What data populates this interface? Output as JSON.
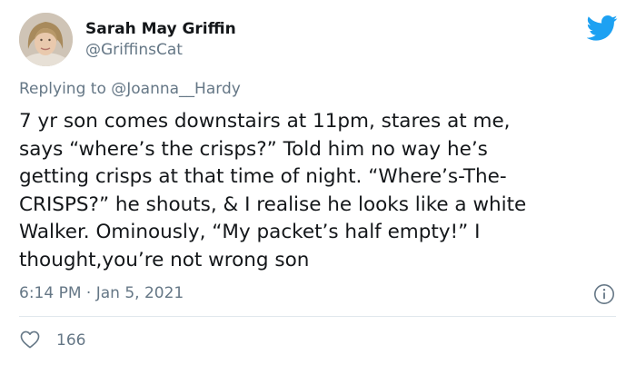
{
  "author": {
    "display_name": "Sarah May Griffin",
    "handle": "@GriffinsCat"
  },
  "reply": {
    "prefix": "Replying to",
    "mention": "@Joanna__Hardy"
  },
  "tweet": {
    "lines": [
      "7 yr son comes downstairs at 11pm, stares at me,",
      "says “where’s the crisps?” Told him no way he’s",
      "getting crisps at that time of night. “Where’s-The-",
      "CRISPS?” he shouts, & I realise he looks like a white",
      "Walker. Ominously, “My packet’s half empty!” I",
      "thought,you’re not wrong son"
    ],
    "timestamp": "6:14 PM · Jan 5, 2021"
  },
  "engagement": {
    "likes": "166"
  },
  "colors": {
    "brand_blue": "#1da1f2",
    "secondary_text": "#657786",
    "primary_text": "#14171a",
    "divider": "#e1e8ed"
  },
  "icons": {
    "logo": "twitter-bird-icon",
    "info": "info-icon",
    "like": "heart-outline-icon"
  }
}
